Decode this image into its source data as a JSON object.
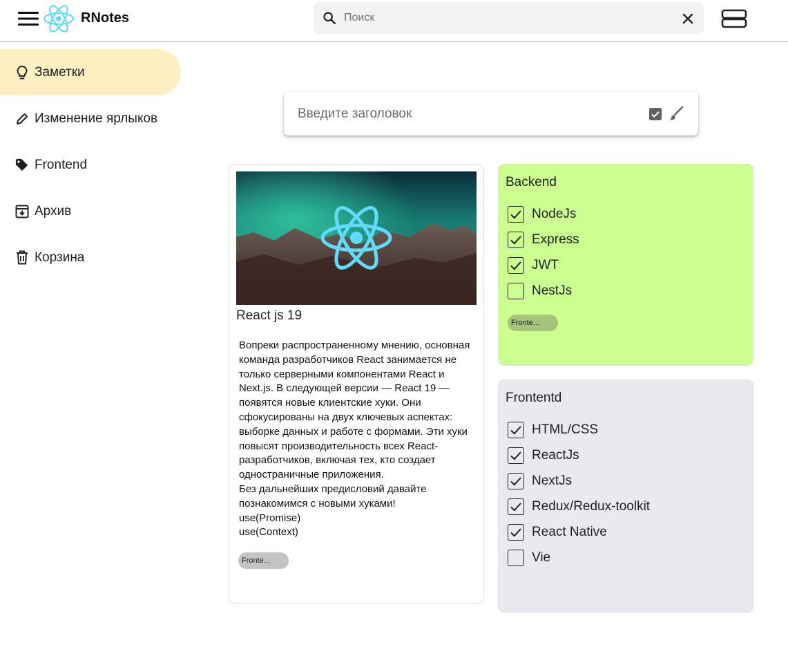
{
  "header": {
    "app_title": "RNotes",
    "search_placeholder": "Поиск",
    "search_value": ""
  },
  "sidebar": {
    "items": [
      {
        "label": "Заметки",
        "icon": "lightbulb-icon",
        "active": true
      },
      {
        "label": "Изменение ярлыков",
        "icon": "pencil-icon",
        "active": false
      },
      {
        "label": "Frontend",
        "icon": "tag-icon",
        "active": false
      },
      {
        "label": "Архив",
        "icon": "archive-icon",
        "active": false
      },
      {
        "label": "Корзина",
        "icon": "trash-icon",
        "active": false
      }
    ]
  },
  "composer": {
    "title_placeholder": "Введите заголовок"
  },
  "notes": [
    {
      "title": "React js 19",
      "body": "Вопреки распространенному мнению, основная команда разработчиков React занимается не только серверными компонентами React и Next.js. В следующей версии — React 19 — появятся новые клиентские хуки. Они сфокусированы на двух ключевых аспектах: выборке данных и работе с формами. Эти хуки повысят производительность всех React-разработчиков, включая тех, кто создает одностраничные приложения.\nБез дальнейших предисловий давайте познакомимся с новыми хуками!\nuse(Promise)\nuse(Context)",
      "label": "Fronte...",
      "color": "#ffffff"
    },
    {
      "title": "Backend",
      "color": "#ccff90",
      "label": "Fronte...",
      "todos": [
        {
          "text": "NodeJs",
          "checked": true
        },
        {
          "text": "Express",
          "checked": true
        },
        {
          "text": "JWT",
          "checked": true
        },
        {
          "text": "NestJs",
          "checked": false
        }
      ]
    },
    {
      "title": "Frontentd",
      "color": "#e8eaed",
      "todos": [
        {
          "text": "HTML/CSS",
          "checked": true
        },
        {
          "text": "ReactJs",
          "checked": true
        },
        {
          "text": "NextJs",
          "checked": true
        },
        {
          "text": "Redux/Redux-toolkit",
          "checked": true
        },
        {
          "text": "React Native",
          "checked": true
        },
        {
          "text": "Vie",
          "checked": false
        }
      ]
    }
  ],
  "colors": {
    "accent_react": "#61dafb",
    "sidebar_active": "#feefc3"
  }
}
